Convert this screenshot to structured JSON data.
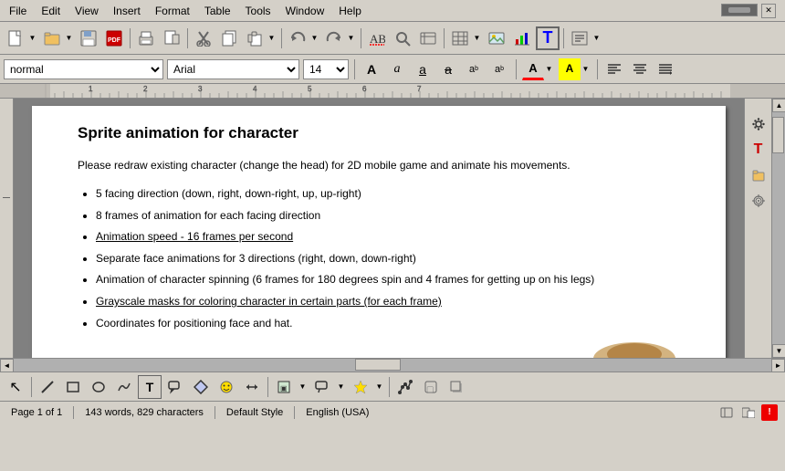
{
  "menu": {
    "items": [
      "File",
      "Edit",
      "View",
      "Insert",
      "Format",
      "Table",
      "Tools",
      "Window",
      "Help"
    ]
  },
  "toolbar": {
    "buttons": [
      "new",
      "open",
      "save",
      "pdf",
      "print",
      "preview",
      "cut",
      "copy",
      "paste",
      "undo",
      "redo",
      "spellcheck",
      "find",
      "paragraph"
    ]
  },
  "format_bar": {
    "style_value": "normal",
    "font_value": "Arial",
    "size_value": "14",
    "bold_label": "A",
    "italic_label": "a",
    "underline_label": "a",
    "strikethrough_label": "a",
    "shadow_label": "a",
    "outline_label": "a",
    "superscript_label": "a",
    "subscript_label": "a",
    "font_color_label": "A",
    "highlight_label": "A"
  },
  "document": {
    "title": "Sprite animation for character",
    "intro": "Please redraw existing character (change the head) for 2D mobile game and animate his movements.",
    "bullet_items": [
      "5 facing direction (down, right, down-right, up, up-right)",
      "8 frames of animation for each facing direction",
      "Animation speed - 16 frames per second",
      "Separate face animations for 3 directions (right, down, down-right)",
      "Animation of character spinning (6 frames for 180 degrees spin and 4 frames for getting up on his legs)",
      "Grayscale masks for coloring character in certain parts (for each frame)",
      "Coordinates for positioning face and hat."
    ]
  },
  "status_bar": {
    "page_info": "Page 1 of 1",
    "word_count": "143 words, 829 characters",
    "style": "Default Style",
    "language": "English (USA)"
  },
  "sidebar_right": {
    "buttons": [
      "⚙",
      "T",
      "📁",
      "◎"
    ]
  },
  "draw_toolbar": {
    "buttons": [
      "↖",
      "/",
      "□",
      "○",
      "✏",
      "T",
      "💬",
      "◇",
      "☺",
      "↔",
      "▣",
      "💬",
      "★",
      "⌂",
      "🔒",
      "▢",
      "🎭"
    ]
  }
}
